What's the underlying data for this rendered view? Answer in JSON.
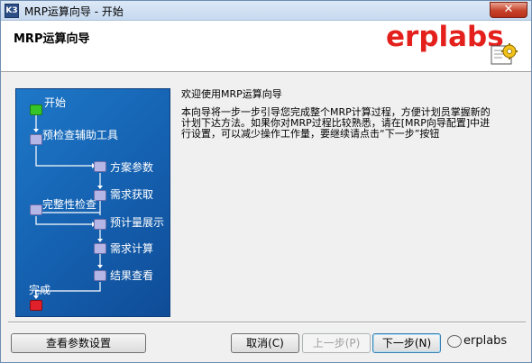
{
  "window": {
    "title": "MRP运算向导 - 开始",
    "app_icon_text": "K3",
    "close_label": "✕"
  },
  "header": {
    "title": "MRP运算向导",
    "brand": "erplabs",
    "icon": "wizard-gear-icon"
  },
  "flow": {
    "steps": [
      {
        "label": "开始",
        "color": "#35c528"
      },
      {
        "label": "预检查辅助工具",
        "color": "#b6b6e6"
      },
      {
        "label": "方案参数",
        "color": "#b6b6e6"
      },
      {
        "label": "需求获取",
        "color": "#b6b6e6"
      },
      {
        "label": "完整性检查",
        "color": "#b6b6e6"
      },
      {
        "label": "预计量展示",
        "color": "#b6b6e6"
      },
      {
        "label": "需求计算",
        "color": "#b6b6e6"
      },
      {
        "label": "结果查看",
        "color": "#b6b6e6"
      },
      {
        "label": "完成",
        "color": "#e0202a"
      }
    ]
  },
  "content": {
    "welcome": "欢迎使用MRP运算向导",
    "description": "本向导将一步一步引导您完成整个MRP计算过程，方便计划员掌握新的计划下达方法。如果你对MRP过程比较熟悉，请在[MRP向导配置]中进行设置，可以减少操作工作量，要继续请点击“下一步”按钮"
  },
  "footer": {
    "params_button": "查看参数设置",
    "cancel_button": "取消(C)",
    "prev_button": "上一步(P)",
    "next_button": "下一步(N)",
    "watermark": "erplabs"
  }
}
